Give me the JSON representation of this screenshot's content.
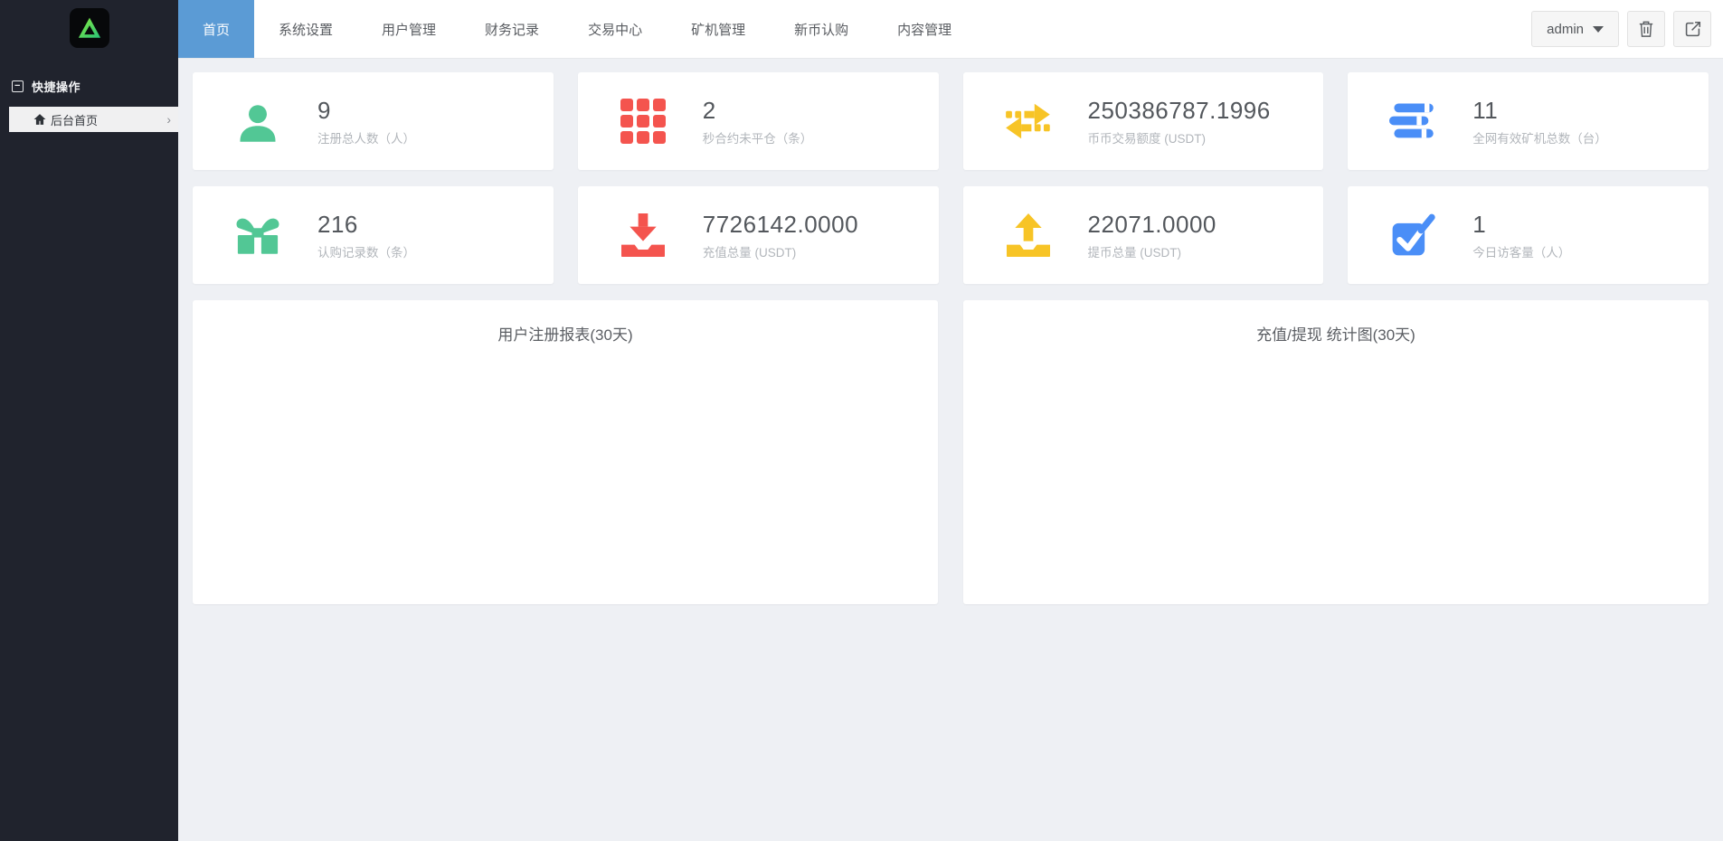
{
  "brand": {
    "logo_icon": "green-a-logo"
  },
  "topnav": {
    "tabs": [
      {
        "label": "首页",
        "active": true
      },
      {
        "label": "系统设置",
        "active": false
      },
      {
        "label": "用户管理",
        "active": false
      },
      {
        "label": "财务记录",
        "active": false
      },
      {
        "label": "交易中心",
        "active": false
      },
      {
        "label": "矿机管理",
        "active": false
      },
      {
        "label": "新币认购",
        "active": false
      },
      {
        "label": "内容管理",
        "active": false
      }
    ],
    "user_button": {
      "label": "admin",
      "icon": "caret-down-icon"
    },
    "action_buttons": [
      {
        "icon": "trash-icon"
      },
      {
        "icon": "logout-icon"
      }
    ]
  },
  "sidebar": {
    "section": {
      "icon": "collapse-icon",
      "title": "快捷操作"
    },
    "items": [
      {
        "icon": "home-icon",
        "label": "后台首页",
        "chevron": "›"
      }
    ]
  },
  "stats": [
    {
      "icon": "user-icon",
      "color": "#52c795",
      "value": "9",
      "label": "注册总人数（人）"
    },
    {
      "icon": "grid-icon",
      "color": "#f4544e",
      "value": "2",
      "label": "秒合约未平仓（条）"
    },
    {
      "icon": "transfer-arrows-icon",
      "color": "#f7c426",
      "value": "250386787.1996",
      "label": "币币交易额度 (USDT)"
    },
    {
      "icon": "server-list-icon",
      "color": "#4a8ef7",
      "value": "11",
      "label": "全网有效矿机总数（台）"
    },
    {
      "icon": "gift-icon",
      "color": "#52c795",
      "value": "216",
      "label": "认购记录数（条）"
    },
    {
      "icon": "download-icon",
      "color": "#f4544e",
      "value": "7726142.0000",
      "label": "充值总量 (USDT)"
    },
    {
      "icon": "upload-icon",
      "color": "#f7c426",
      "value": "22071.0000",
      "label": "提币总量 (USDT)"
    },
    {
      "icon": "check-square-icon",
      "color": "#4a8ef7",
      "value": "1",
      "label": "今日访客量（人）"
    }
  ],
  "charts": [
    {
      "title": "用户注册报表(30天)"
    },
    {
      "title": "充值/提现 统计图(30天)"
    }
  ],
  "colors": {
    "sidebar_bg": "#20232d",
    "active_tab": "#5b9bd5",
    "content_bg": "#eef0f4",
    "green": "#52c795",
    "red": "#f4544e",
    "yellow": "#f7c426",
    "blue": "#4a8ef7"
  }
}
